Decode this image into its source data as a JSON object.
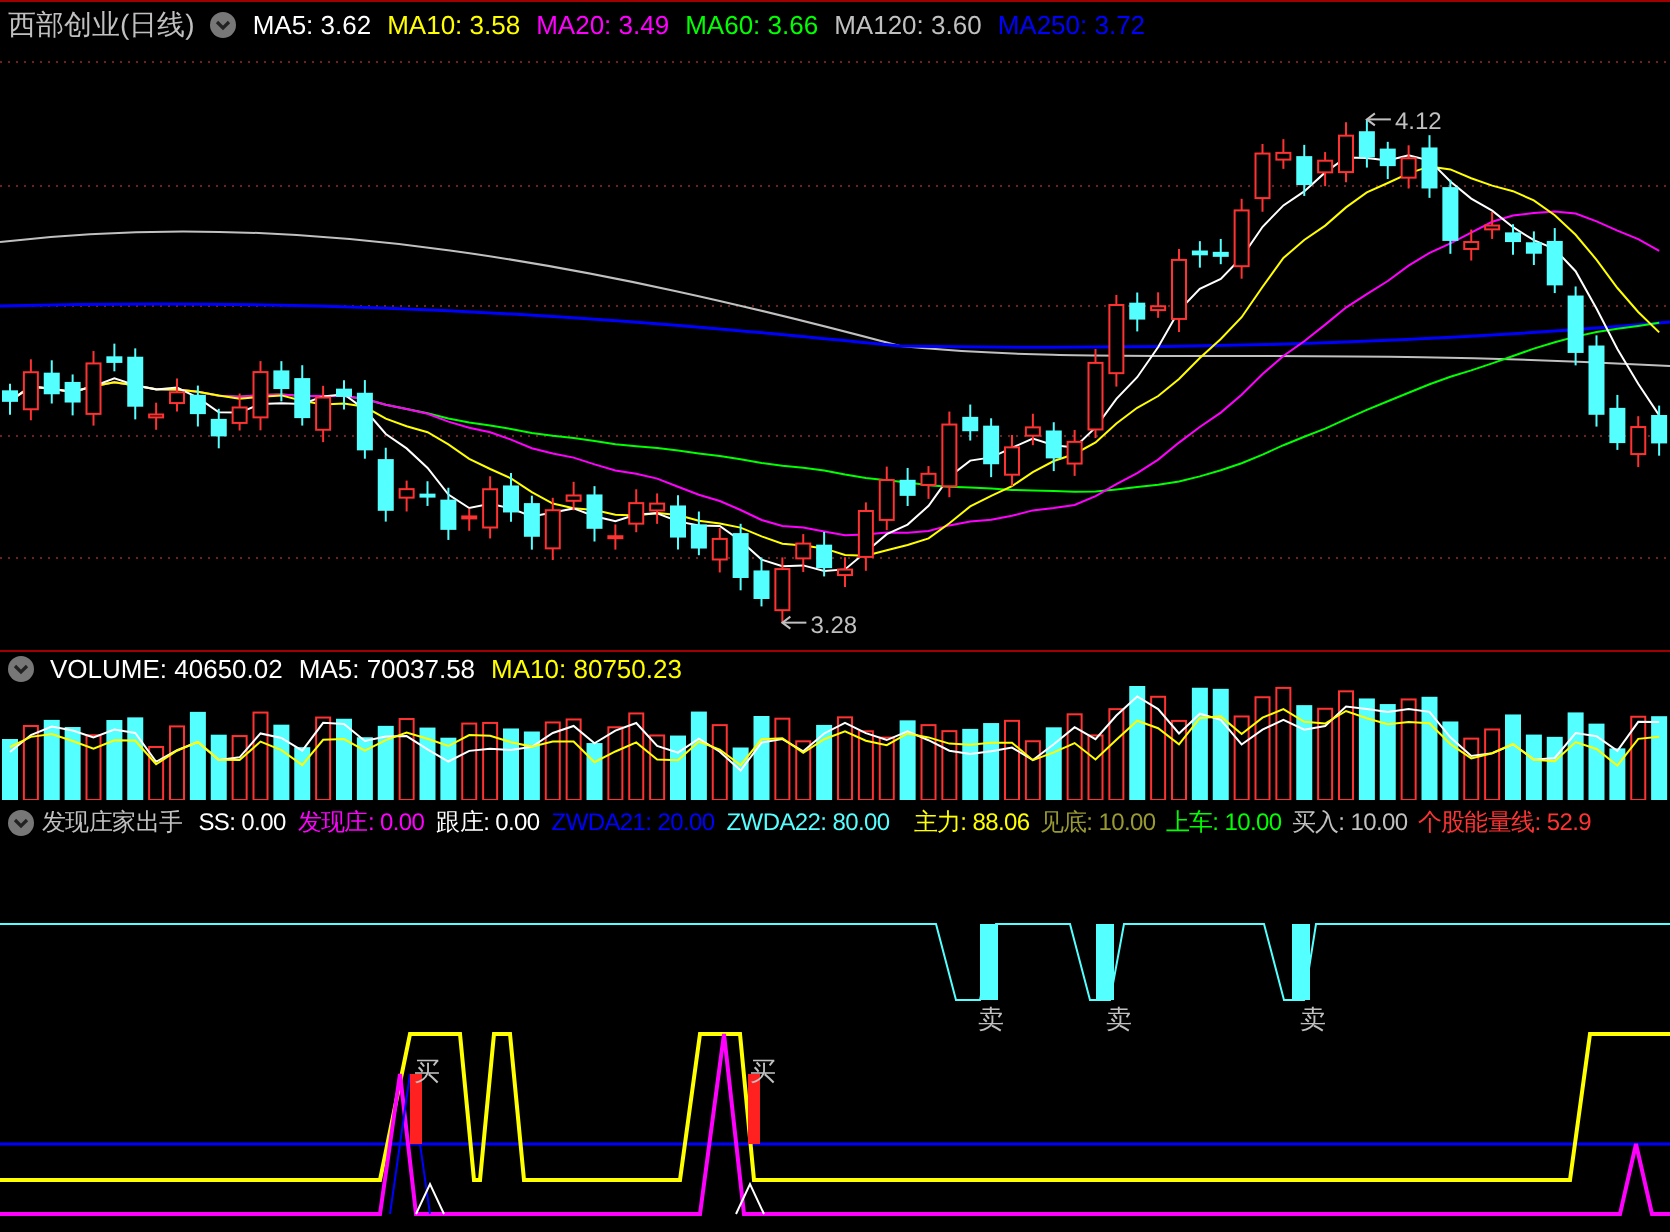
{
  "price_panel": {
    "title": "西部创业(日线)",
    "legend": [
      {
        "text": "MA5: 3.62",
        "color": "#ffffff"
      },
      {
        "text": "MA10: 3.58",
        "color": "#ffff00"
      },
      {
        "text": "MA20: 3.49",
        "color": "#ff00ff"
      },
      {
        "text": "MA60: 3.66",
        "color": "#00ff00"
      },
      {
        "text": "MA120: 3.60",
        "color": "#c0c0c0"
      },
      {
        "text": "MA250: 3.72",
        "color": "#0000ff"
      }
    ],
    "high_label": "4.12",
    "low_label": "3.28"
  },
  "volume_panel": {
    "legend": [
      {
        "text": "VOLUME: 40650.02",
        "color": "#ffffff"
      },
      {
        "text": "MA5: 70037.58",
        "color": "#ffffff"
      },
      {
        "text": "MA10: 80750.23",
        "color": "#ffff00"
      }
    ]
  },
  "indicator_panel": {
    "title": "发现庄家出手",
    "legend_left": [
      {
        "text": "SS: 0.00",
        "color": "#ffffff"
      },
      {
        "text": "发现庄: 0.00",
        "color": "#ff00ff"
      },
      {
        "text": "跟庄: 0.00",
        "color": "#ffffff"
      },
      {
        "text": "ZWDA21: 20.00",
        "color": "#0000ff"
      },
      {
        "text": "ZWDA22: 80.00",
        "color": "#55ffff"
      }
    ],
    "legend_right": [
      {
        "text": "主力: 88.06",
        "color": "#ffff00"
      },
      {
        "text": "见底: 10.00",
        "color": "#999933"
      },
      {
        "text": "上车: 10.00",
        "color": "#00ff00"
      },
      {
        "text": "买入: 10.00",
        "color": "#c0c0c0"
      },
      {
        "text": "个股能量线: 52.9",
        "color": "#ff3333"
      }
    ],
    "sell_labels": [
      "卖",
      "卖",
      "卖"
    ],
    "buy_labels": [
      "买",
      "买"
    ]
  }
}
